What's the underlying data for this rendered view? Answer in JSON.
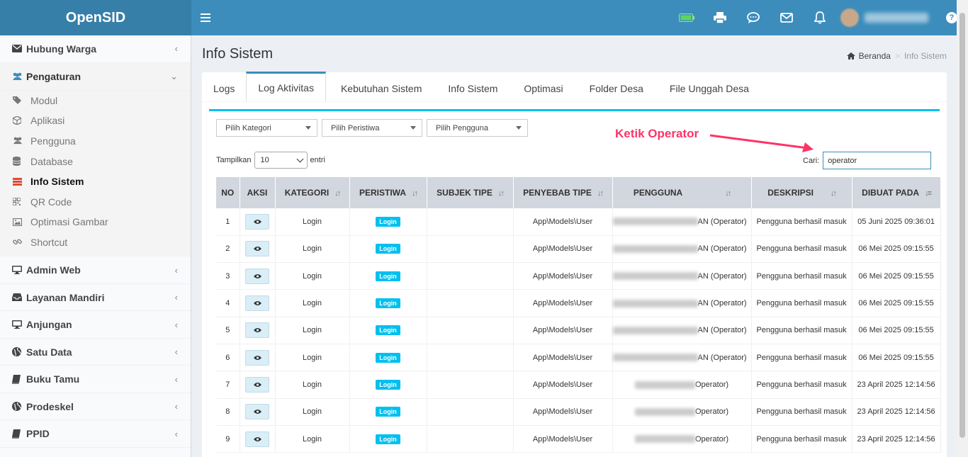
{
  "app": {
    "title": "OpenSID"
  },
  "colors": {
    "primary": "#3c8dbc",
    "accent": "#00c0ef",
    "annotation": "#ff3366"
  },
  "topbar": {
    "icons": [
      "battery-icon",
      "printer-icon",
      "chat-icon",
      "mail-icon",
      "bell-icon"
    ],
    "help": "?"
  },
  "sidebar": {
    "items": [
      {
        "label": "Hubung Warga",
        "icon": "envelope-icon"
      },
      {
        "label": "Pengaturan",
        "icon": "users-icon",
        "open": true,
        "children": [
          {
            "label": "Modul",
            "icon": "tags-icon"
          },
          {
            "label": "Aplikasi",
            "icon": "cube-icon"
          },
          {
            "label": "Pengguna",
            "icon": "users-icon"
          },
          {
            "label": "Database",
            "icon": "database-icon"
          },
          {
            "label": "Info Sistem",
            "icon": "server-icon",
            "active": true
          },
          {
            "label": "QR Code",
            "icon": "qrcode-icon"
          },
          {
            "label": "Optimasi Gambar",
            "icon": "image-icon"
          },
          {
            "label": "Shortcut",
            "icon": "link-icon"
          }
        ]
      },
      {
        "label": "Admin Web",
        "icon": "desktop-icon"
      },
      {
        "label": "Layanan Mandiri",
        "icon": "inbox-icon"
      },
      {
        "label": "Anjungan",
        "icon": "desktop-icon"
      },
      {
        "label": "Satu Data",
        "icon": "globe-icon"
      },
      {
        "label": "Buku Tamu",
        "icon": "book-icon"
      },
      {
        "label": "Prodeskel",
        "icon": "globe-icon"
      },
      {
        "label": "PPID",
        "icon": "book-icon"
      }
    ]
  },
  "page": {
    "title": "Info Sistem",
    "breadcrumb": {
      "home": "Beranda",
      "separator": ">",
      "current": "Info Sistem"
    }
  },
  "tabs": [
    "Logs",
    "Log Aktivitas",
    "Kebutuhan Sistem",
    "Info Sistem",
    "Optimasi",
    "Folder Desa",
    "File Unggah Desa"
  ],
  "active_tab": "Log Aktivitas",
  "filters": {
    "kategori": "Pilih Kategori",
    "peristiwa": "Pilih Peristiwa",
    "pengguna": "Pilih Pengguna"
  },
  "table_controls": {
    "show_label": "Tampilkan",
    "length_value": "10",
    "entries_label": "entri",
    "search_label": "Cari:",
    "search_value": "operator"
  },
  "annotation": {
    "text": "Ketik Operator"
  },
  "table": {
    "columns": [
      "NO",
      "AKSI",
      "KATEGORI",
      "PERISTIWA",
      "SUBJEK TIPE",
      "PENYEBAB TIPE",
      "PENGGUNA",
      "DESKRIPSI",
      "DIBUAT PADA"
    ],
    "rows": [
      {
        "no": "1",
        "kategori": "Login",
        "peristiwa": "Login",
        "subjek": "",
        "penyebab": "App\\Models\\User",
        "pengguna": "AN (Operator)",
        "deskripsi": "Pengguna berhasil masuk",
        "dibuat": "05 Juni 2025 09:36:01"
      },
      {
        "no": "2",
        "kategori": "Login",
        "peristiwa": "Login",
        "subjek": "",
        "penyebab": "App\\Models\\User",
        "pengguna": "AN (Operator)",
        "deskripsi": "Pengguna berhasil masuk",
        "dibuat": "06 Mei 2025 09:15:55"
      },
      {
        "no": "3",
        "kategori": "Login",
        "peristiwa": "Login",
        "subjek": "",
        "penyebab": "App\\Models\\User",
        "pengguna": "AN (Operator)",
        "deskripsi": "Pengguna berhasil masuk",
        "dibuat": "06 Mei 2025 09:15:55"
      },
      {
        "no": "4",
        "kategori": "Login",
        "peristiwa": "Login",
        "subjek": "",
        "penyebab": "App\\Models\\User",
        "pengguna": "AN (Operator)",
        "deskripsi": "Pengguna berhasil masuk",
        "dibuat": "06 Mei 2025 09:15:55"
      },
      {
        "no": "5",
        "kategori": "Login",
        "peristiwa": "Login",
        "subjek": "",
        "penyebab": "App\\Models\\User",
        "pengguna": "AN (Operator)",
        "deskripsi": "Pengguna berhasil masuk",
        "dibuat": "06 Mei 2025 09:15:55"
      },
      {
        "no": "6",
        "kategori": "Login",
        "peristiwa": "Login",
        "subjek": "",
        "penyebab": "App\\Models\\User",
        "pengguna": "AN (Operator)",
        "deskripsi": "Pengguna berhasil masuk",
        "dibuat": "06 Mei 2025 09:15:55"
      },
      {
        "no": "7",
        "kategori": "Login",
        "peristiwa": "Login",
        "subjek": "",
        "penyebab": "App\\Models\\User",
        "pengguna": "Operator)",
        "deskripsi": "Pengguna berhasil masuk",
        "dibuat": "23 April 2025 12:14:56"
      },
      {
        "no": "8",
        "kategori": "Login",
        "peristiwa": "Login",
        "subjek": "",
        "penyebab": "App\\Models\\User",
        "pengguna": "Operator)",
        "deskripsi": "Pengguna berhasil masuk",
        "dibuat": "23 April 2025 12:14:56"
      },
      {
        "no": "9",
        "kategori": "Login",
        "peristiwa": "Login",
        "subjek": "",
        "penyebab": "App\\Models\\User",
        "pengguna": "Operator)",
        "deskripsi": "Pengguna berhasil masuk",
        "dibuat": "23 April 2025 12:14:56"
      }
    ]
  }
}
